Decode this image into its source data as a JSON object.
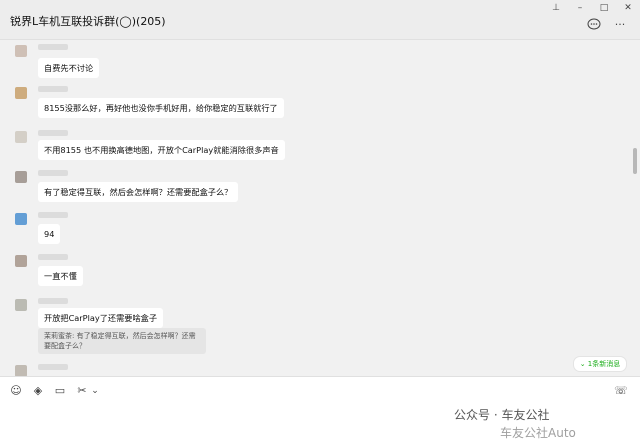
{
  "window": {
    "title": "锐界L车机互联投诉群(◯)(205)",
    "controls": [
      "⊥",
      "–",
      "□",
      "✕"
    ]
  },
  "header": {
    "more_label": "···"
  },
  "messages": [
    {
      "text": "自费先不讨论",
      "avatar_color": "#c9b7ab"
    },
    {
      "text": "8155没那么好，再好他也没你手机好用，给你稳定的互联就行了",
      "avatar_color": "#c8a06a"
    },
    {
      "text": "不用8155 也不用换高德地图，开放个CarPlay就能消除很多声音",
      "avatar_color": "#cfc9c0"
    },
    {
      "text": "有了稳定得互联，然后会怎样啊？还需要配盒子么？",
      "avatar_color": "#9a8f88"
    },
    {
      "text": "94",
      "avatar_color": "#4a8fd0"
    },
    {
      "text": "一直不懂",
      "avatar_color": "#a69589"
    },
    {
      "text": "开放把CarPlay了还需要啥盒子",
      "avatar_color": "#b2b2a8"
    }
  ],
  "quote": {
    "text": "茉莉蜜茶: 有了稳定得互联，然后会怎样啊？还需要配盒子么？"
  },
  "new_badge": {
    "label": "⌄ 1条新消息"
  },
  "toolbar": {
    "emoji_icon": "☺",
    "package_icon": "◈",
    "folder_icon": "▭",
    "scissors_icon": "✂",
    "chevron_icon": "⌄",
    "phone_icon": "☏"
  },
  "watermark": {
    "line1": "公众号 · 车友公社",
    "line2": "车友公社Auto"
  }
}
